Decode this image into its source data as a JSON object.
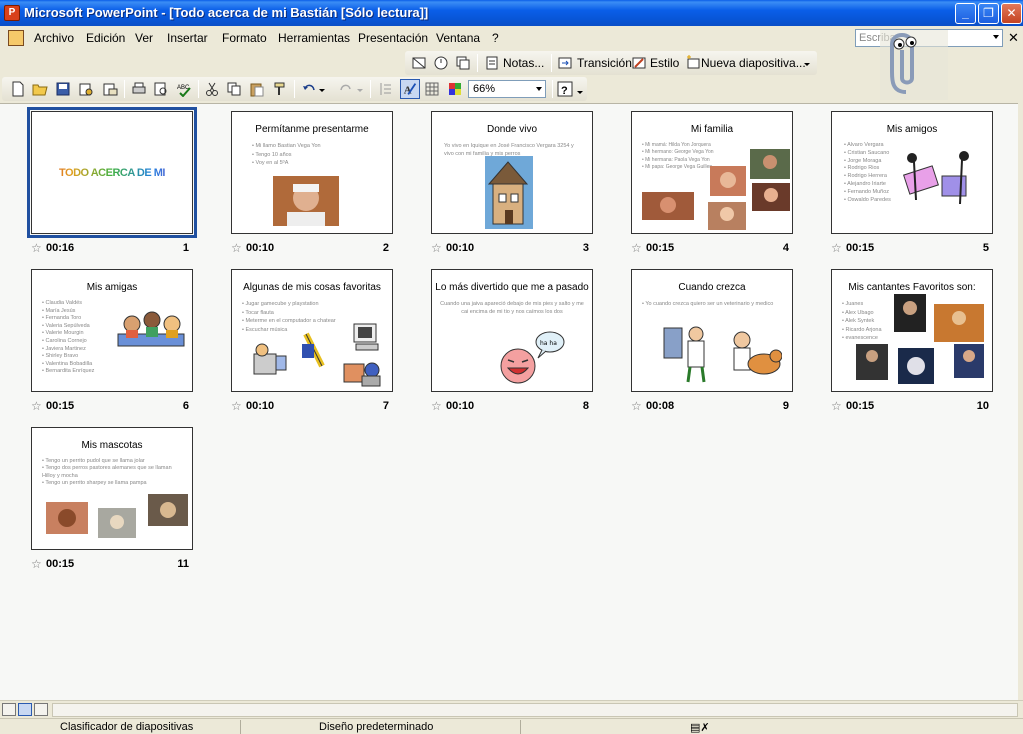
{
  "window": {
    "title": "Microsoft PowerPoint - [Todo acerca de mi Bastián [Sólo lectura]]",
    "app_icon_letter": "P"
  },
  "menu": {
    "items": [
      "Archivo",
      "Edición",
      "Ver",
      "Insertar",
      "Formato",
      "Herramientas",
      "Presentación",
      "Ventana",
      "?"
    ],
    "help_placeholder": "Escriba"
  },
  "toolbar": {
    "notes_label": "Notas...",
    "transition_label": "Transición",
    "style_label": "Estilo",
    "new_slide_label": "Nueva diapositiva...",
    "zoom": "66%"
  },
  "slides": [
    {
      "number": "1",
      "time": "00:16",
      "title": "TODO ACERCA DE MI",
      "bullets": []
    },
    {
      "number": "2",
      "time": "00:10",
      "title": "Permítanme presentarme",
      "bullets": [
        "Mi llamo Bastian Vega Yon",
        "Tengo 10 años",
        "Voy en al 5ºA"
      ]
    },
    {
      "number": "3",
      "time": "00:10",
      "title": "Donde vivo",
      "body": "Yo vivo en Iquique en José Francisco Vergara 3254 y vivo con mi familia y mis perros"
    },
    {
      "number": "4",
      "time": "00:15",
      "title": "Mi familia",
      "bullets": [
        "Mi mamá: Hilda Yon Jorquera",
        "Mi hermano: George Vega Yon",
        "Mi hermana: Paola Vega Yon",
        "Mi papa: George Vega Guillen"
      ]
    },
    {
      "number": "5",
      "time": "00:15",
      "title": "Mis amigos",
      "bullets": [
        "Alvaro Vergara",
        "Cristian Saucano",
        "Jorge Moraga",
        "Rodrigo Rios",
        "Rodrigo Herrera",
        "Alejandro Iriarte",
        "Fernando Muñoz",
        "Oswaldo Paredes"
      ]
    },
    {
      "number": "6",
      "time": "00:15",
      "title": "Mis amigas",
      "bullets": [
        "Claudia Valdés",
        "María Jesús",
        "Fernanda Toro",
        "Valeria Sepúlveda",
        "Valerie Mourgin",
        "Carolina Cornejo",
        "Javiera Martinez",
        "Shirley Bravo",
        "Valentina Bobadilla",
        "Bernardita Enríquez"
      ]
    },
    {
      "number": "7",
      "time": "00:10",
      "title": "Algunas de mis cosas favoritas",
      "bullets": [
        "Jugar gamecube y playstation",
        "Tocar flauta",
        "Meterme en el computador a chatear",
        "Escuchar música"
      ]
    },
    {
      "number": "8",
      "time": "00:10",
      "title": "Lo más divertido que me a pasado",
      "body": "Cuando una jaiva apareció debajo de mis pies y salto y me cai encima de mi tio y nos caímos los dos"
    },
    {
      "number": "9",
      "time": "00:08",
      "title": "Cuando crezca",
      "bullets": [
        "Yo cuando crezca quiero ser un veterinario y medico"
      ]
    },
    {
      "number": "10",
      "time": "00:15",
      "title": "Mis cantantes Favoritos son:",
      "bullets": [
        "Juanes",
        "Alex Ubago",
        "Alek Syntek",
        "Ricardo Arjona",
        "evanescence"
      ]
    },
    {
      "number": "11",
      "time": "00:15",
      "title": "Mis mascotas",
      "bullets": [
        "Tengo un perrito pudol que se llama jolar",
        "Tengo dos perros pastores alemanes que se llaman Hilloy y mocha",
        "Tengo un perrito sharpey se llama pampa"
      ]
    }
  ],
  "status": {
    "view": "Clasificador de diapositivas",
    "design": "Diseño predeterminado"
  },
  "colors": {
    "titlebar": "#0a5ee8",
    "selection": "#2050a0"
  }
}
